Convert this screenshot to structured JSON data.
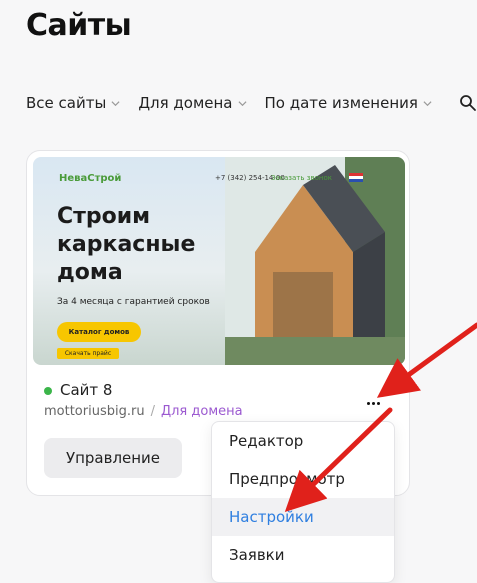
{
  "page_title": "Сайты",
  "filters": {
    "all_sites": "Все сайты",
    "for_domain": "Для домена",
    "sort": "По дате изменения"
  },
  "card": {
    "thumbnail": {
      "brand": "НеваСтрой",
      "phone": "+7 (342) 254-14-00",
      "call": "Заказать звонок",
      "headline_1": "Строим",
      "headline_2": "каркасные",
      "headline_3": "дома",
      "subtitle": "За 4 месяца с гарантией сроков",
      "button": "Каталог домов",
      "button2": "Скачать прайс"
    },
    "status_color": "#3bb54a",
    "site_name": "Сайт 8",
    "domain": "mottoriusbig.ru",
    "separator": "/",
    "domain_link": "Для домена",
    "manage_button": "Управление"
  },
  "menu": {
    "items": [
      "Редактор",
      "Предпросмотр",
      "Настройки",
      "Заявки"
    ],
    "active_index": 2,
    "active_color": "#2f7fe0"
  },
  "annotation_color": "#e0211b"
}
